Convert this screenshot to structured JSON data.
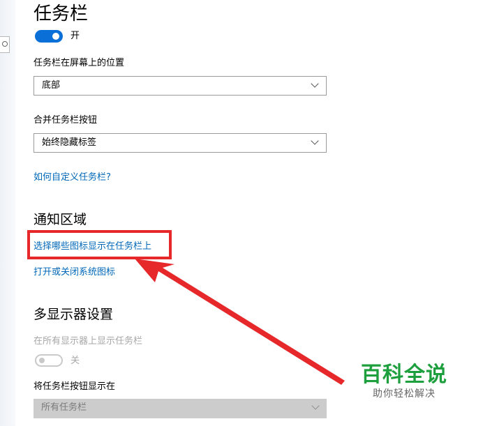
{
  "taskbar": {
    "title": "任务栏",
    "lock_toggle": {
      "state_label": "开",
      "on": true
    }
  },
  "position": {
    "label": "任务栏在屏幕上的位置",
    "value": "底部"
  },
  "combine": {
    "label": "合并任务栏按钮",
    "value": "始终隐藏标签"
  },
  "customize_link": "如何自定义任务栏?",
  "notification_area": {
    "title": "通知区域",
    "select_icons_link": "选择哪些图标显示在任务栏上",
    "system_icons_link": "打开或关闭系统图标"
  },
  "multi_display": {
    "title": "多显示器设置",
    "show_all_label": "在所有显示器上显示任务栏",
    "show_all_toggle": {
      "state_label": "关",
      "on": false
    },
    "buttons_on_label": "将任务栏按钮显示在",
    "buttons_on_value": "所有任务栏"
  },
  "watermark": {
    "title": "百科全说",
    "subtitle": "助你轻松解决"
  },
  "colors": {
    "accent": "#0a6fd6",
    "link": "#0067b8",
    "annotation": "#e6282b",
    "watermark": "#1e9f3e"
  }
}
